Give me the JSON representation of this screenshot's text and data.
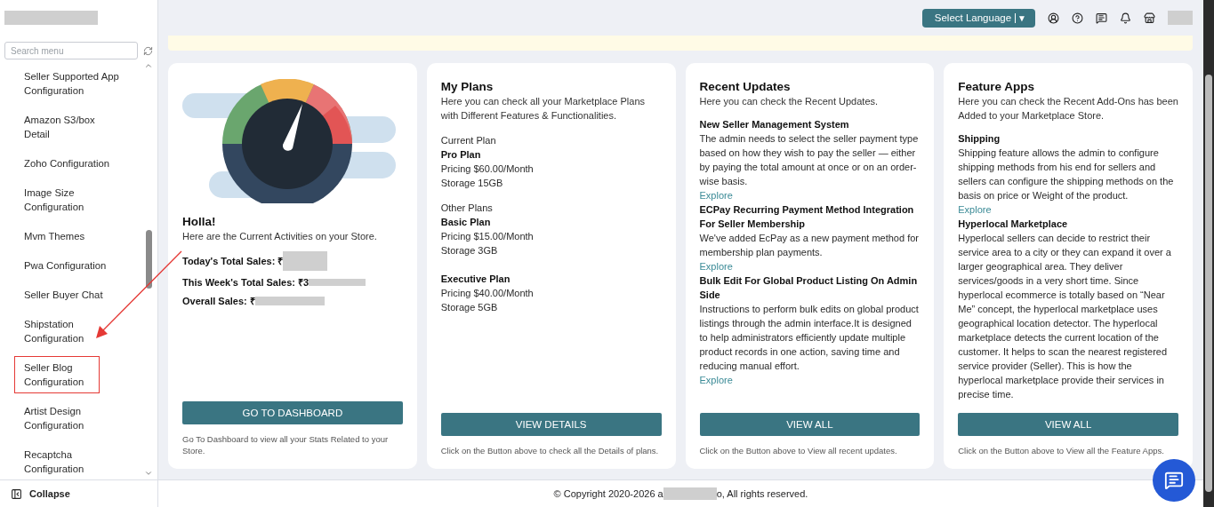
{
  "sidebar": {
    "search": {
      "placeholder": "Search menu"
    },
    "items": [
      {
        "label": "Seller Supported App Configuration",
        "highlighted": false
      },
      {
        "label": "Amazon S3/box Detail",
        "highlighted": false
      },
      {
        "label": "Zoho Configuration",
        "highlighted": false
      },
      {
        "label": "Image Size Configuration",
        "highlighted": false
      },
      {
        "label": "Mvm Themes",
        "highlighted": false
      },
      {
        "label": "Pwa Configuration",
        "highlighted": false
      },
      {
        "label": "Seller Buyer Chat",
        "highlighted": false
      },
      {
        "label": "Shipstation Configuration",
        "highlighted": false
      },
      {
        "label": "Seller Blog Configuration",
        "highlighted": true
      },
      {
        "label": "Artist Design Configuration",
        "highlighted": false
      },
      {
        "label": "Recaptcha Configuration",
        "highlighted": false
      }
    ],
    "collapse": "Collapse"
  },
  "topbar": {
    "language": "Select Language",
    "caret": "▼"
  },
  "cards": [
    {
      "kind": "activity",
      "title": "Holla!",
      "subtitle": "Here are the Current Activities on your Store.",
      "stats": [
        {
          "label": "Today's Total Sales:",
          "value": "₹"
        },
        {
          "label": "This Week's Total Sales:",
          "value": "₹3"
        },
        {
          "label": "Overall Sales:",
          "value": "₹"
        }
      ],
      "button": "GO TO DASHBOARD",
      "note": "Go To Dashboard to view all your Stats Related to your Store."
    },
    {
      "kind": "plans",
      "title": "My Plans",
      "subtitle": "Here you can check all your Marketplace Plans with Different Features & Functionalities.",
      "sections": [
        {
          "heading": "Current Plan",
          "plans": [
            {
              "name": "Pro Plan",
              "pricing": "Pricing $60.00/Month",
              "storage": "Storage 15GB"
            }
          ]
        },
        {
          "heading": "Other Plans",
          "plans": [
            {
              "name": "Basic Plan",
              "pricing": "Pricing $15.00/Month",
              "storage": "Storage 3GB"
            },
            {
              "name": "Executive Plan",
              "pricing": "Pricing $40.00/Month",
              "storage": "Storage 5GB"
            }
          ]
        }
      ],
      "button": "VIEW DETAILS",
      "note": "Click on the Button above to check all the Details of plans."
    },
    {
      "kind": "updates",
      "title": "Recent Updates",
      "subtitle": "Here you can check the Recent Updates.",
      "items": [
        {
          "title": "New Seller Management System",
          "body": "The admin needs to select the seller payment type based on how they wish to pay the seller — either by paying the total amount at once or on an order-wise basis.",
          "link": "Explore"
        },
        {
          "title": "ECPay Recurring Payment Method Integration For Seller Membership",
          "body": "We've added EcPay as a new payment method for membership plan payments.",
          "link": "Explore"
        },
        {
          "title": "Bulk Edit For Global Product Listing On Admin Side",
          "body": "Instructions to perform bulk edits on global product listings through the admin interface.It is designed to help administrators efficiently update multiple product records in one action, saving time and reducing manual effort.",
          "link": "Explore"
        }
      ],
      "button": "VIEW ALL",
      "note": "Click on the Button above to View all recent updates."
    },
    {
      "kind": "updates",
      "title": "Feature Apps",
      "subtitle": "Here you can check the Recent Add-Ons has been Added to your Marketplace Store.",
      "items": [
        {
          "title": "Shipping",
          "body": "Shipping feature allows the admin to configure shipping methods from his end for sellers and sellers can configure the shipping methods on the basis on price or Weight of the product.",
          "link": "Explore"
        },
        {
          "title": "Hyperlocal Marketplace",
          "body": "Hyperlocal sellers can decide to restrict their service area to a city or they can expand it over a larger geographical area. They deliver services/goods in a very short time. Since hyperlocal ecommerce is totally based on “Near Me” concept, the hyperlocal marketplace uses geographical location detector. The hyperlocal marketplace detects the current location of the customer. It helps to scan the nearest registered service provider (Seller). This is how the hyperlocal marketplace provide their services in precise time."
        }
      ],
      "button": "VIEW ALL",
      "note": "Click on the Button above to View all the Feature Apps."
    }
  ],
  "footer": {
    "before": "© Copyright 2020-2026 a",
    "after": "o, All rights reserved."
  }
}
